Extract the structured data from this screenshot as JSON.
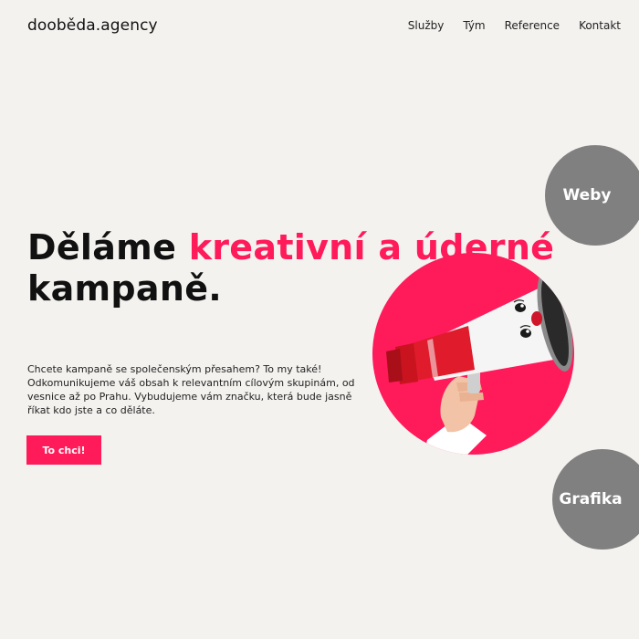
{
  "header": {
    "logo": "dooběda.agency",
    "nav": [
      "Služby",
      "Tým",
      "Reference",
      "Kontakt"
    ]
  },
  "hero": {
    "headline_part1": "Děláme ",
    "headline_accent": "kreativní a úderné",
    "headline_part2": "kampaně.",
    "description": "Chcete kampaně se společenským přesahem? To my také! Odkomunikujeme váš obsah k relevantním cílovým skupinám, od vesnice až po Prahu. Vybudujeme vám značku, která bude jasně říkat kdo jste a co děláte.",
    "cta_label": "To chci!",
    "image_icon": "megaphone-icon"
  },
  "services": {
    "weby": "Weby",
    "grafika": "Grafika"
  },
  "colors": {
    "accent": "#ff1a5a",
    "background": "#f4f2ef",
    "bubble": "#808080",
    "text": "#111111"
  }
}
